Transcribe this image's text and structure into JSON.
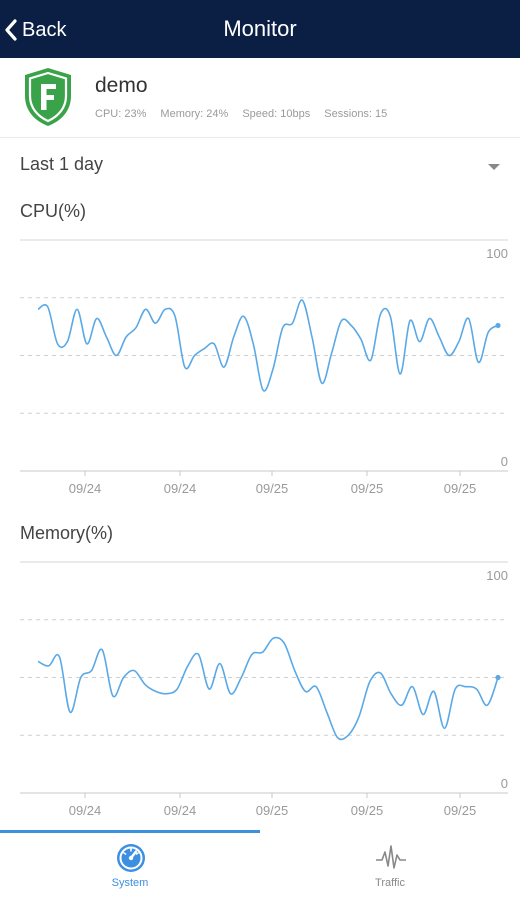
{
  "header": {
    "back_label": "Back",
    "title": "Monitor"
  },
  "device": {
    "name": "demo",
    "stats": {
      "cpu": "CPU: 23%",
      "memory": "Memory: 24%",
      "speed": "Speed: 10bps",
      "sessions": "Sessions: 15"
    }
  },
  "range": {
    "selected": "Last 1 day"
  },
  "chart_data": [
    {
      "type": "line",
      "title": "CPU(%)",
      "xlabel": "",
      "ylabel": "",
      "ylim": [
        0,
        100
      ],
      "y_ticks": [
        "100",
        "0"
      ],
      "grid": "dashed horizontal at 25/50/75",
      "x_tick_labels": [
        "09/24",
        "09/24",
        "09/25",
        "09/25",
        "09/25"
      ],
      "line_color": "#5aa9e6",
      "x": [
        0,
        1,
        2,
        3,
        4,
        5,
        6,
        7,
        8,
        9,
        10,
        11,
        12,
        13,
        14,
        15,
        16,
        17,
        18,
        19,
        20,
        21,
        22,
        23,
        24,
        25,
        26,
        27,
        28,
        29,
        30,
        31,
        32,
        33,
        34,
        35,
        36,
        37,
        38,
        39,
        40,
        41,
        42,
        43,
        44,
        45,
        46,
        47
      ],
      "values": [
        70,
        71,
        55,
        56,
        70,
        55,
        66,
        58,
        50,
        58,
        62,
        70,
        64,
        70,
        67,
        45,
        50,
        53,
        55,
        45,
        58,
        67,
        55,
        35,
        44,
        62,
        64,
        74,
        58,
        38,
        51,
        65,
        63,
        57,
        48,
        68,
        67,
        42,
        65,
        56,
        66,
        58,
        50,
        56,
        66,
        47,
        60,
        63
      ]
    },
    {
      "type": "line",
      "title": "Memory(%)",
      "xlabel": "",
      "ylabel": "",
      "ylim": [
        0,
        100
      ],
      "y_ticks": [
        "100",
        "0"
      ],
      "grid": "dashed horizontal at 25/50/75",
      "x_tick_labels": [
        "09/24",
        "09/24",
        "09/25",
        "09/25",
        "09/25"
      ],
      "line_color": "#5aa9e6",
      "x": [
        0,
        1,
        2,
        3,
        4,
        5,
        6,
        7,
        8,
        9,
        10,
        11,
        12,
        13,
        14,
        15,
        16,
        17,
        18,
        19,
        20,
        21,
        22,
        23,
        24,
        25,
        26,
        27,
        28,
        29,
        30,
        31,
        32,
        33,
        34,
        35,
        36,
        37,
        38,
        39,
        40,
        41,
        42,
        43,
        44,
        45,
        46,
        47
      ],
      "values": [
        57,
        55,
        59,
        35,
        50,
        53,
        62,
        42,
        50,
        53,
        47,
        44,
        43,
        45,
        55,
        60,
        45,
        56,
        43,
        50,
        60,
        61,
        67,
        65,
        53,
        44,
        46,
        35,
        24,
        25,
        33,
        48,
        52,
        43,
        38,
        46,
        34,
        44,
        28,
        45,
        46,
        45,
        38,
        50
      ]
    }
  ],
  "tabs": [
    {
      "label": "System",
      "icon": "dashboard-icon",
      "active": true
    },
    {
      "label": "Traffic",
      "icon": "waveform-icon",
      "active": false
    }
  ],
  "colors": {
    "navbar": "#0b1f45",
    "accent": "#3d8fe0",
    "line": "#5aa9e6",
    "logo_green": "#3aa34a"
  }
}
